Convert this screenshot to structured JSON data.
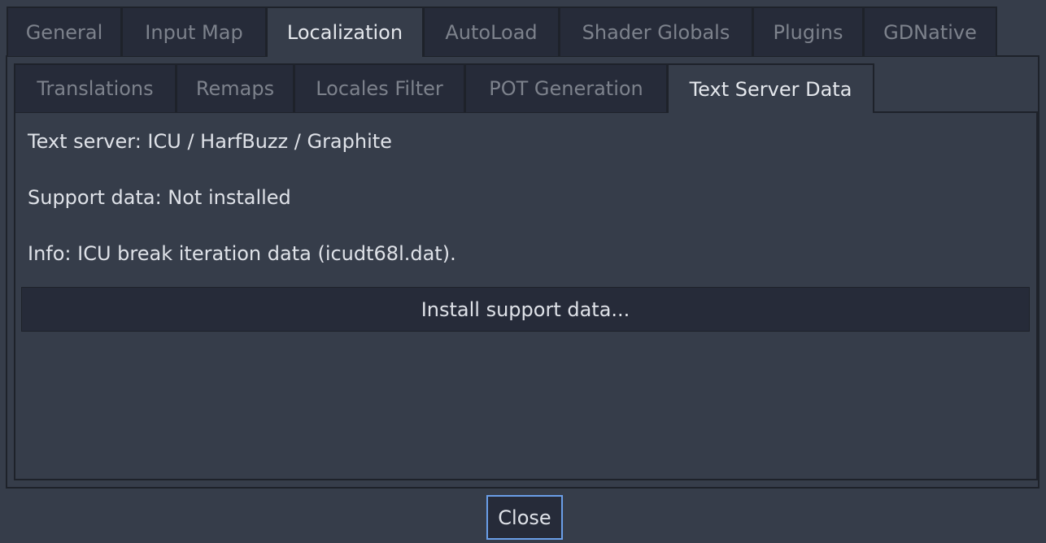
{
  "top_tabs": [
    {
      "label": "General"
    },
    {
      "label": "Input Map"
    },
    {
      "label": "Localization"
    },
    {
      "label": "AutoLoad"
    },
    {
      "label": "Shader Globals"
    },
    {
      "label": "Plugins"
    },
    {
      "label": "GDNative"
    }
  ],
  "active_top_tab": "Localization",
  "sub_tabs": [
    {
      "label": "Translations"
    },
    {
      "label": "Remaps"
    },
    {
      "label": "Locales Filter"
    },
    {
      "label": "POT Generation"
    },
    {
      "label": "Text Server Data"
    }
  ],
  "active_sub_tab": "Text Server Data",
  "text_server_data": {
    "text_server": "Text server: ICU / HarfBuzz / Graphite",
    "support_data": "Support data: Not installed",
    "info": "Info: ICU break iteration data (icudt68l.dat).",
    "install_button": "Install support data..."
  },
  "close_button": "Close",
  "colors": {
    "focus_border": "#6a9ee8",
    "background": "#363d4a",
    "tab_inactive": "#262b39"
  }
}
